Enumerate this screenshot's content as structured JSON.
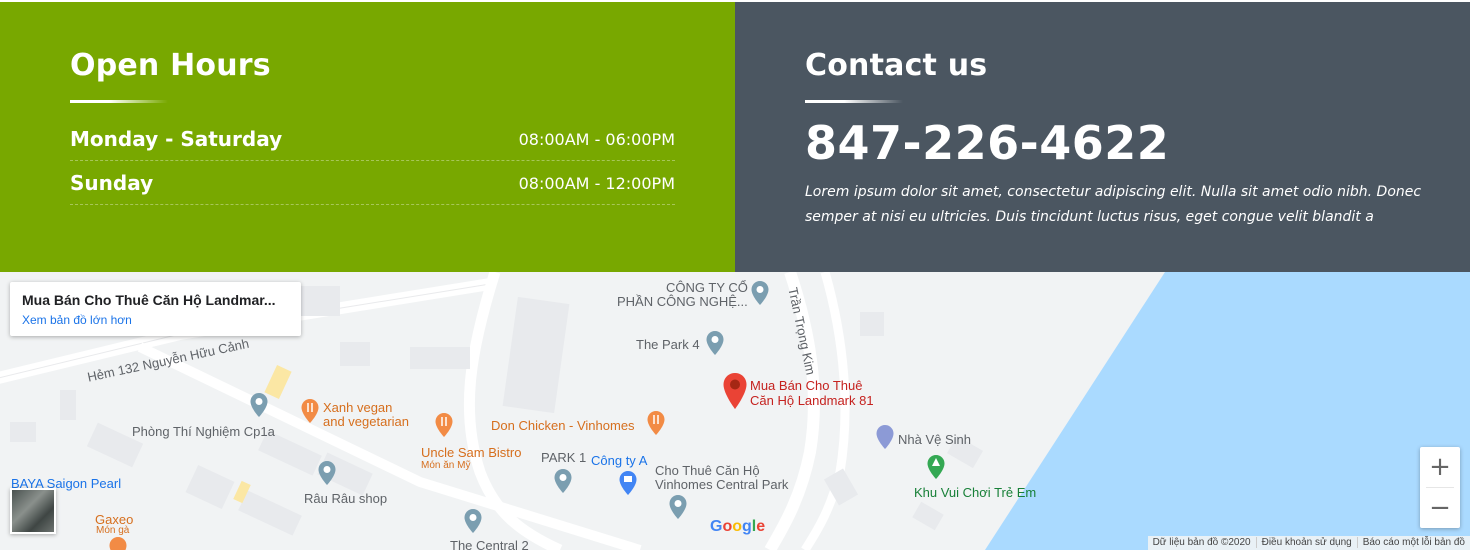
{
  "hours": {
    "title": "Open Hours",
    "rows": [
      {
        "day": "Monday - Saturday",
        "time": "08:00AM - 06:00PM"
      },
      {
        "day": "Sunday",
        "time": "08:00AM - 12:00PM"
      }
    ]
  },
  "contact": {
    "title": "Contact us",
    "phone": "847-226-4622",
    "text": "Lorem ipsum dolor sit amet, consectetur adipiscing elit. Nulla sit amet odio nibh. Donec semper at nisi eu ultricies. Duis tincidunt luctus risus, eget congue velit blandit a"
  },
  "map": {
    "card": {
      "name": "Mua Bán Cho Thuê Căn Hộ Landmar...",
      "link": "Xem bản đồ lớn hơn"
    },
    "marker": {
      "line1": "Mua Bán Cho Thuê",
      "line2": "Căn Hộ Landmark 81"
    },
    "places": {
      "cong_ty_1": "CÔNG TY CỔ",
      "cong_ty_2": "PHẦN CÔNG NGHỆ...",
      "park4": "The Park 4",
      "street_tran": "Trần Trọng Kim",
      "street_hem": "Hẻm 132 Nguyễn Hữu Cảnh",
      "xanh_1": "Xanh vegan",
      "xanh_2": "and vegetarian",
      "don_chicken": "Don Chicken - Vinhomes",
      "phong_thi": "Phòng Thí Nghiệm Cp1a",
      "nha_ve_sinh": "Nhà Vệ Sinh",
      "uncle_sam": "Uncle Sam Bistro",
      "uncle_sam_sub": "Món ăn Mỹ",
      "park1": "PARK 1",
      "cong_ty_a": "Công ty A",
      "cho_thue_1": "Cho Thuê Căn Hộ",
      "cho_thue_2": "Vinhomes Central Park",
      "khu_vui": "Khu Vui Chơi Trẻ Em",
      "baya": "BAYA Saigon Pearl",
      "rau_rau": "Râu Râu shop",
      "gaxeo": "Gaxeo",
      "gaxeo_sub": "Món gà",
      "central2": "The Central 2"
    },
    "zoom_in": "+",
    "zoom_out": "−",
    "logo": "Google",
    "footer": [
      "Dữ liệu bản đồ ©2020",
      "Điều khoản sử dụng",
      "Báo cáo một lỗi bản đồ"
    ],
    "colors": {
      "water": "#aadaff",
      "land": "#f1f3f4",
      "road": "#ffffff",
      "marker": "#ea4335"
    }
  },
  "colors": {
    "hours_bg": "#78a800",
    "contact_bg": "#4b5661"
  }
}
